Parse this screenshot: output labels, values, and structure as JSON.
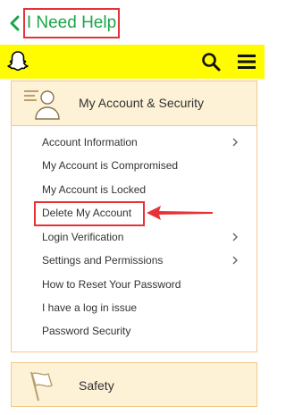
{
  "header": {
    "title": "I Need Help",
    "back_icon": "chevron-left-icon"
  },
  "navbar": {
    "logo_icon": "snapchat-ghost-icon",
    "search_icon": "search-icon",
    "menu_icon": "hamburger-menu-icon"
  },
  "section_account": {
    "title": "My Account & Security",
    "icon": "account-person-icon",
    "items": [
      {
        "label": "Account Information",
        "has_chevron": true
      },
      {
        "label": "My Account is Compromised",
        "has_chevron": false
      },
      {
        "label": "My Account is Locked",
        "has_chevron": false
      },
      {
        "label": "Delete My Account",
        "has_chevron": false,
        "highlighted": true
      },
      {
        "label": "Login Verification",
        "has_chevron": true
      },
      {
        "label": "Settings and Permissions",
        "has_chevron": true
      },
      {
        "label": "How to Reset Your Password",
        "has_chevron": false
      },
      {
        "label": "I have a log in issue",
        "has_chevron": false
      },
      {
        "label": "Password Security",
        "has_chevron": false
      }
    ]
  },
  "section_safety": {
    "title": "Safety",
    "icon": "flag-icon"
  },
  "colors": {
    "accent_green": "#1aa64a",
    "nav_yellow": "#fffc00",
    "highlight_red": "#e53338",
    "card_border": "#f2c88a",
    "card_header_bg": "#fdf1d6"
  }
}
